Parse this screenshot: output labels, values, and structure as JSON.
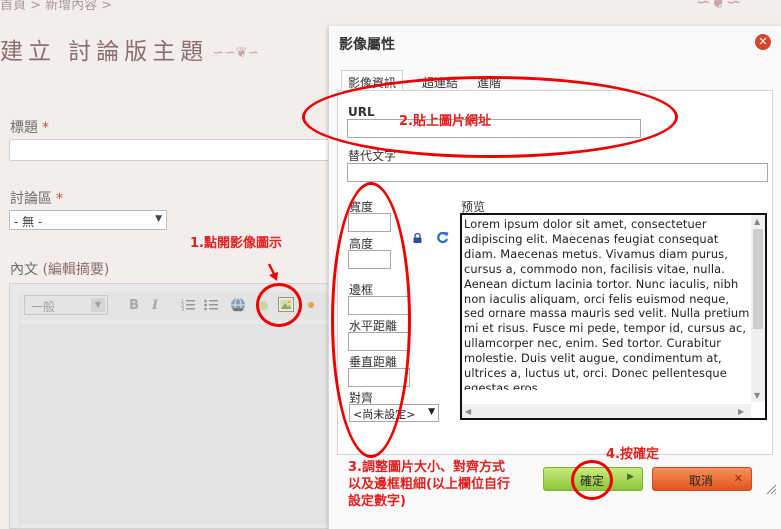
{
  "breadcrumb": "首頁 > 新增內容 >",
  "page": {
    "title": "建立 討論版主題",
    "title_label": "標題",
    "forum_label": "討論區",
    "required_mark": "*",
    "forum_selected": "- 無 -",
    "content_label": "內文",
    "content_sub": "(編輯摘要)"
  },
  "editor": {
    "format_selected": "一般",
    "bold": "B",
    "italic": "I"
  },
  "dialog": {
    "title": "影像屬性",
    "tabs": [
      {
        "label": "影像資訊",
        "active": true
      },
      {
        "label": "超連結",
        "active": false
      },
      {
        "label": "進階",
        "active": false
      }
    ],
    "url_label": "URL",
    "alt_label": "替代文字",
    "width_label": "寬度",
    "height_label": "高度",
    "border_label": "邊框",
    "hspace_label": "水平距離",
    "vspace_label": "垂直距離",
    "align_label": "對齊",
    "align_selected": "<尚未設定>",
    "preview_label": "预览",
    "preview_text": "Lorem ipsum dolor sit amet, consectetuer adipiscing elit. Maecenas feugiat consequat diam. Maecenas metus. Vivamus diam purus, cursus a, commodo non, facilisis vitae, nulla. Aenean dictum lacinia tortor. Nunc iaculis, nibh non iaculis aliquam, orci felis euismod neque, sed ornare massa mauris sed velit. Nulla pretium mi et risus. Fusce mi pede, tempor id, cursus ac, ullamcorper nec, enim. Sed tortor. Curabitur molestie. Duis velit augue, condimentum at, ultrices a, luctus ut, orci. Donec pellentesque egestas eros.",
    "ok": "確定",
    "cancel": "取消"
  },
  "annotations": {
    "step1": "1.點開影像圖示",
    "step2": "2.貼上圖片網址",
    "step3_line1": "3.調整圖片大小、對齊方式",
    "step3_line2": "以及邊框粗細(以上欄位自行",
    "step3_line3": "設定數字)",
    "step4": "4.按確定"
  },
  "colors": {
    "annotation": "#e41f1f",
    "ok_button": "#8dc43a",
    "cancel_button": "#e2551f",
    "close_button": "#d6452f",
    "title_brown": "#8a6d6d"
  },
  "icons": [
    "lock-icon",
    "reset-size-icon",
    "close-icon",
    "image-icon",
    "link-icon",
    "bullet-list-icon",
    "numbered-list-icon",
    "arrow-down-icon"
  ]
}
